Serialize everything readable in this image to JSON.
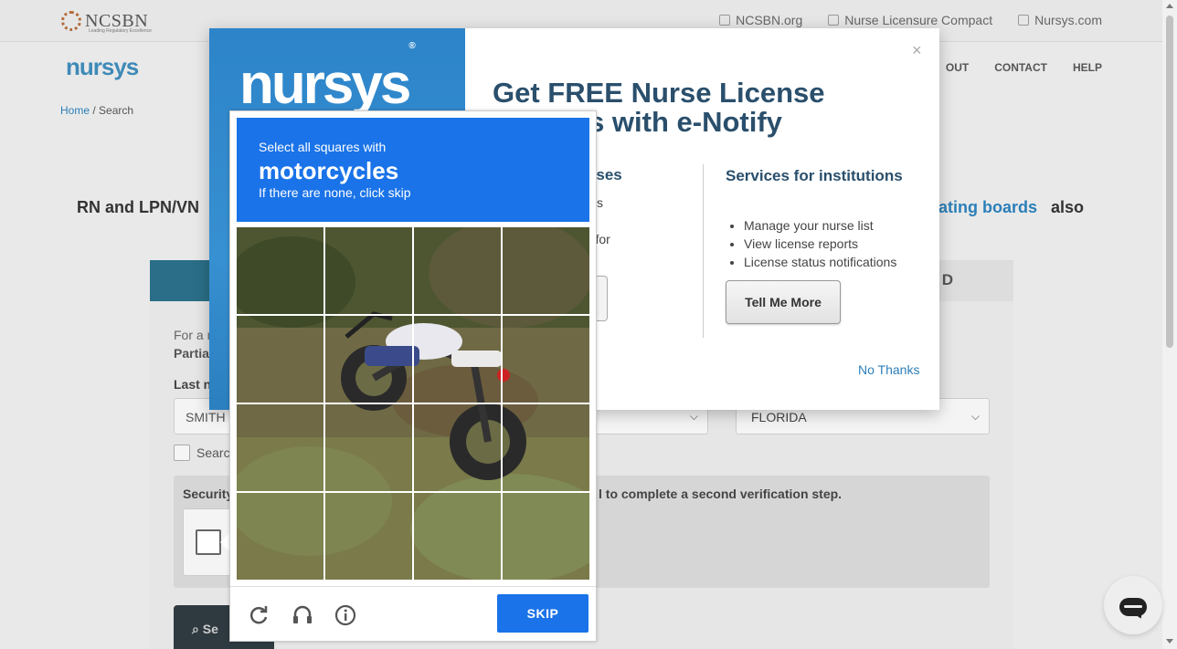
{
  "header": {
    "ncsbn_logo_text": "NCSBN",
    "ncsbn_tagline": "Leading Regulatory Excellence",
    "links": [
      "NCSBN.org",
      "Nurse Licensure Compact",
      "Nursys.com"
    ]
  },
  "nav": {
    "logo_text": "nursys",
    "items": [
      "ABOUT",
      "CONTACT",
      "HELP"
    ],
    "items_partial_first": "OUT"
  },
  "breadcrumb": {
    "home": "Home",
    "separator": "/",
    "current": "Search"
  },
  "page": {
    "lede_left": "RN and LPN/VN",
    "lede_link": "pating boards",
    "lede_right": "also",
    "tab_right_partial": "D",
    "form_text1": "For a n",
    "form_text2": "Partia",
    "last_name_label": "Last n",
    "last_name_value": "SMITH",
    "state_value": "FLORIDA",
    "search_checkbox_label": "Searc",
    "security_label": "Security",
    "security_note": "l to complete a second verification step.",
    "search_button": "Se"
  },
  "modal": {
    "logo_text": "nursys",
    "logo_reg": "®",
    "close": "×",
    "title": "Get FREE Nurse License Updates with e-Notify",
    "col1_heading": "nurses",
    "col1_line1": "nders",
    "col1_line2": "ons for",
    "col2_heading": "Services for institutions",
    "col2_items": [
      "Manage your nurse list",
      "View license reports",
      "License status notifications"
    ],
    "tell_more": "Tell Me More",
    "no_thanks": "No Thanks"
  },
  "captcha": {
    "instruction": "Select all squares with",
    "target": "motorcycles",
    "sub": "If there are none, click skip",
    "skip_label": "SKIP",
    "icons": [
      "reload-icon",
      "audio-icon",
      "info-icon"
    ],
    "colors": {
      "accent": "#1a73e8"
    }
  },
  "colors": {
    "brand": "#2c7fb8",
    "modal_heading": "#2a4f6c"
  }
}
